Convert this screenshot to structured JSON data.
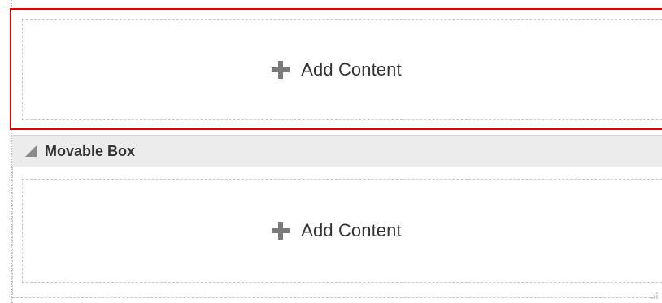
{
  "regions": {
    "top": {
      "add_content_label": "Add Content",
      "icon": "plus-icon"
    },
    "movable_box": {
      "title": "Movable Box",
      "collapse_icon": "triangle-collapse-icon",
      "add_content_label": "Add Content",
      "icon": "plus-icon"
    }
  },
  "colors": {
    "selection_border": "#e00000",
    "header_bg": "#ececec",
    "icon_gray": "#7a7a7a"
  }
}
